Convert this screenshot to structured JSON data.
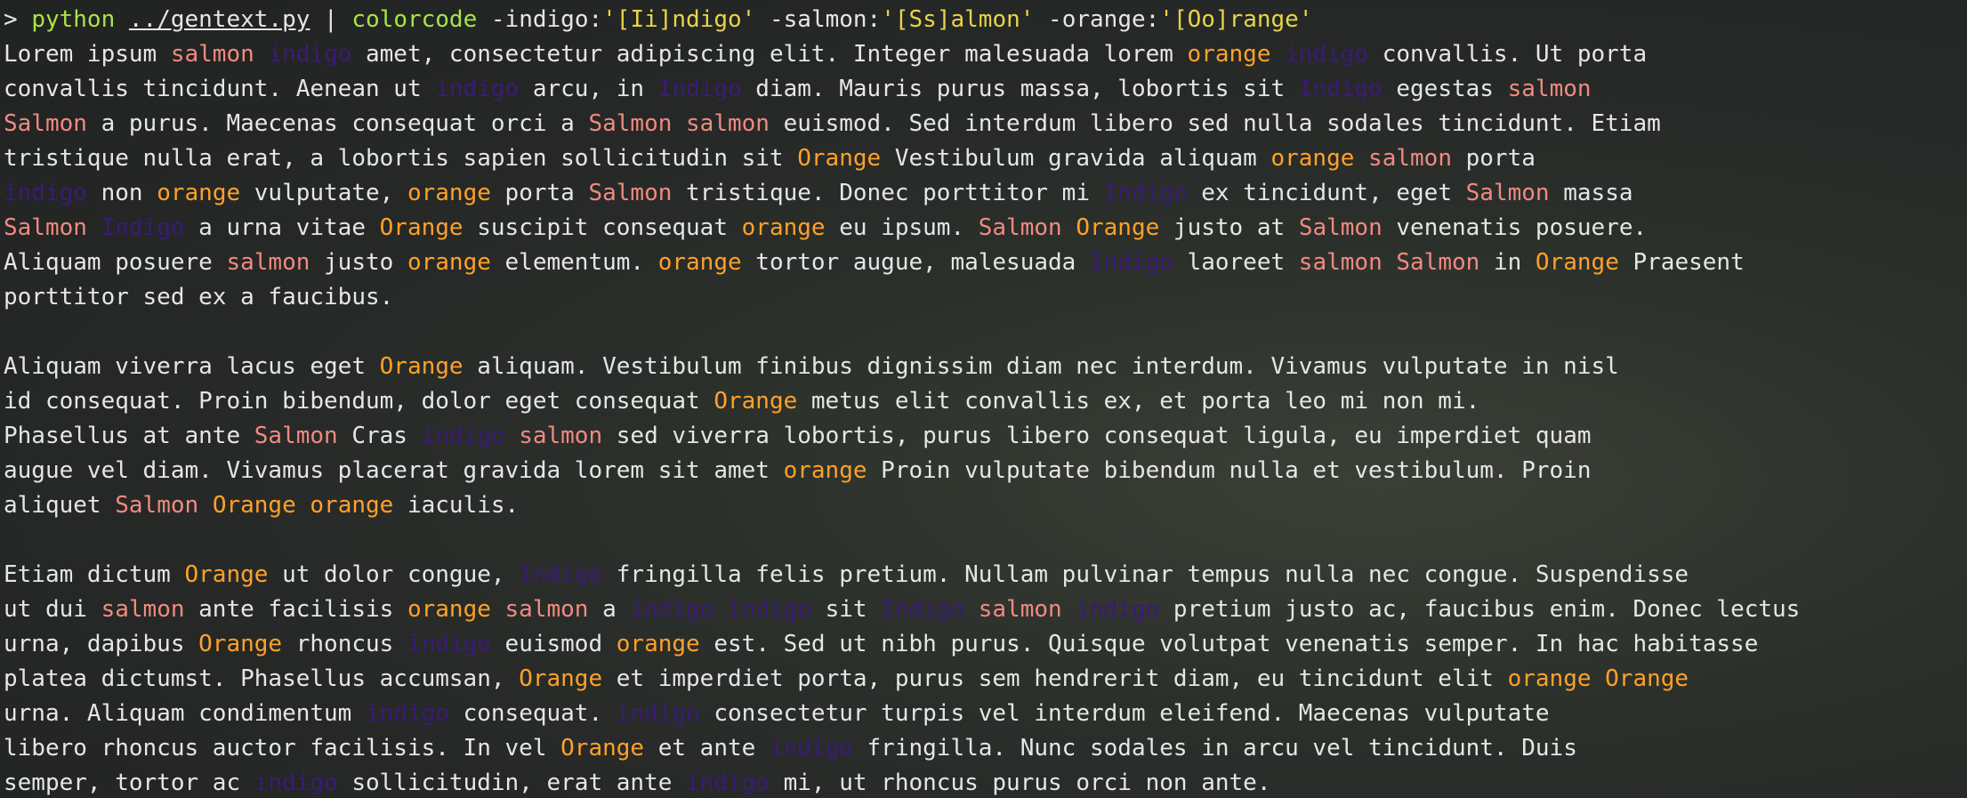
{
  "terminal": {
    "lines": [
      [
        [
          "prompt",
          "> "
        ],
        [
          "cmd",
          "python"
        ],
        [
          "arg",
          " "
        ],
        [
          "path",
          "../gentext.py"
        ],
        [
          "arg",
          " | "
        ],
        [
          "cmd",
          "colorcode"
        ],
        [
          "arg",
          " -indigo:"
        ],
        [
          "str",
          "'[Ii]ndigo'"
        ],
        [
          "arg",
          " -salmon:"
        ],
        [
          "str",
          "'[Ss]almon'"
        ],
        [
          "arg",
          " -orange:"
        ],
        [
          "str",
          "'[Oo]range'"
        ]
      ],
      [
        [
          "plain",
          "Lorem ipsum "
        ],
        [
          "salmon",
          "salmon"
        ],
        [
          "plain",
          " "
        ],
        [
          "indigo",
          "indigo"
        ],
        [
          "plain",
          " amet, consectetur adipiscing elit. Integer malesuada lorem "
        ],
        [
          "orange",
          "orange"
        ],
        [
          "plain",
          " "
        ],
        [
          "indigo",
          "indigo"
        ],
        [
          "plain",
          " convallis. Ut porta"
        ]
      ],
      [
        [
          "plain",
          "convallis tincidunt. Aenean ut "
        ],
        [
          "indigo",
          "indigo"
        ],
        [
          "plain",
          " arcu, in "
        ],
        [
          "indigo",
          "Indigo"
        ],
        [
          "plain",
          " diam. Mauris purus massa, lobortis sit "
        ],
        [
          "indigo",
          "Indigo"
        ],
        [
          "plain",
          " egestas "
        ],
        [
          "salmon",
          "salmon"
        ]
      ],
      [
        [
          "salmon",
          "Salmon"
        ],
        [
          "plain",
          " a purus. Maecenas consequat orci a "
        ],
        [
          "salmon",
          "Salmon"
        ],
        [
          "plain",
          " "
        ],
        [
          "salmon",
          "salmon"
        ],
        [
          "plain",
          " euismod. Sed interdum libero sed nulla sodales tincidunt. Etiam"
        ]
      ],
      [
        [
          "plain",
          "tristique nulla erat, a lobortis sapien sollicitudin sit "
        ],
        [
          "orange",
          "Orange"
        ],
        [
          "plain",
          " Vestibulum gravida aliquam "
        ],
        [
          "orange",
          "orange"
        ],
        [
          "plain",
          " "
        ],
        [
          "salmon",
          "salmon"
        ],
        [
          "plain",
          " porta"
        ]
      ],
      [
        [
          "indigo",
          "indigo"
        ],
        [
          "plain",
          " non "
        ],
        [
          "orange",
          "orange"
        ],
        [
          "plain",
          " vulputate, "
        ],
        [
          "orange",
          "orange"
        ],
        [
          "plain",
          " porta "
        ],
        [
          "salmon",
          "Salmon"
        ],
        [
          "plain",
          " tristique. Donec porttitor mi "
        ],
        [
          "indigo",
          "Indigo"
        ],
        [
          "plain",
          " ex tincidunt, eget "
        ],
        [
          "salmon",
          "Salmon"
        ],
        [
          "plain",
          " massa"
        ]
      ],
      [
        [
          "salmon",
          "Salmon"
        ],
        [
          "plain",
          " "
        ],
        [
          "indigo",
          "Indigo"
        ],
        [
          "plain",
          " a urna vitae "
        ],
        [
          "orange",
          "Orange"
        ],
        [
          "plain",
          " suscipit consequat "
        ],
        [
          "orange",
          "orange"
        ],
        [
          "plain",
          " eu ipsum. "
        ],
        [
          "salmon",
          "Salmon"
        ],
        [
          "plain",
          " "
        ],
        [
          "orange",
          "Orange"
        ],
        [
          "plain",
          " justo at "
        ],
        [
          "salmon",
          "Salmon"
        ],
        [
          "plain",
          " venenatis posuere."
        ]
      ],
      [
        [
          "plain",
          "Aliquam posuere "
        ],
        [
          "salmon",
          "salmon"
        ],
        [
          "plain",
          " justo "
        ],
        [
          "orange",
          "orange"
        ],
        [
          "plain",
          " elementum. "
        ],
        [
          "orange",
          "orange"
        ],
        [
          "plain",
          " tortor augue, malesuada "
        ],
        [
          "indigo",
          "Indigo"
        ],
        [
          "plain",
          " laoreet "
        ],
        [
          "salmon",
          "salmon"
        ],
        [
          "plain",
          " "
        ],
        [
          "salmon",
          "Salmon"
        ],
        [
          "plain",
          " in "
        ],
        [
          "orange",
          "Orange"
        ],
        [
          "plain",
          " Praesent"
        ]
      ],
      [
        [
          "plain",
          "porttitor sed ex a faucibus."
        ]
      ],
      [
        [
          "plain",
          " "
        ]
      ],
      [
        [
          "plain",
          "Aliquam viverra lacus eget "
        ],
        [
          "orange",
          "Orange"
        ],
        [
          "plain",
          " aliquam. Vestibulum finibus dignissim diam nec interdum. Vivamus vulputate in nisl"
        ]
      ],
      [
        [
          "plain",
          "id consequat. Proin bibendum, dolor eget consequat "
        ],
        [
          "orange",
          "Orange"
        ],
        [
          "plain",
          " metus elit convallis ex, et porta leo mi non mi."
        ]
      ],
      [
        [
          "plain",
          "Phasellus at ante "
        ],
        [
          "salmon",
          "Salmon"
        ],
        [
          "plain",
          " Cras "
        ],
        [
          "indigo",
          "indigo"
        ],
        [
          "plain",
          " "
        ],
        [
          "salmon",
          "salmon"
        ],
        [
          "plain",
          " sed viverra lobortis, purus libero consequat ligula, eu imperdiet quam"
        ]
      ],
      [
        [
          "plain",
          "augue vel diam. Vivamus placerat gravida lorem sit amet "
        ],
        [
          "orange",
          "orange"
        ],
        [
          "plain",
          " Proin vulputate bibendum nulla et vestibulum. Proin"
        ]
      ],
      [
        [
          "plain",
          "aliquet "
        ],
        [
          "salmon",
          "Salmon"
        ],
        [
          "plain",
          " "
        ],
        [
          "orange",
          "Orange"
        ],
        [
          "plain",
          " "
        ],
        [
          "orange",
          "orange"
        ],
        [
          "plain",
          " iaculis."
        ]
      ],
      [
        [
          "plain",
          " "
        ]
      ],
      [
        [
          "plain",
          "Etiam dictum "
        ],
        [
          "orange",
          "Orange"
        ],
        [
          "plain",
          " ut dolor congue, "
        ],
        [
          "indigo",
          "Indigo"
        ],
        [
          "plain",
          " fringilla felis pretium. Nullam pulvinar tempus nulla nec congue. Suspendisse"
        ]
      ],
      [
        [
          "plain",
          "ut dui "
        ],
        [
          "salmon",
          "salmon"
        ],
        [
          "plain",
          " ante facilisis "
        ],
        [
          "orange",
          "orange"
        ],
        [
          "plain",
          " "
        ],
        [
          "salmon",
          "salmon"
        ],
        [
          "plain",
          " a "
        ],
        [
          "indigo",
          "indigo"
        ],
        [
          "plain",
          " "
        ],
        [
          "indigo",
          "indigo"
        ],
        [
          "plain",
          " sit "
        ],
        [
          "indigo",
          "Indigo"
        ],
        [
          "plain",
          " "
        ],
        [
          "salmon",
          "salmon"
        ],
        [
          "plain",
          " "
        ],
        [
          "indigo",
          "indigo"
        ],
        [
          "plain",
          " pretium justo ac, faucibus enim. Donec lectus"
        ]
      ],
      [
        [
          "plain",
          "urna, dapibus "
        ],
        [
          "orange",
          "Orange"
        ],
        [
          "plain",
          " rhoncus "
        ],
        [
          "indigo",
          "indigo"
        ],
        [
          "plain",
          " euismod "
        ],
        [
          "orange",
          "orange"
        ],
        [
          "plain",
          " est. Sed ut nibh purus. Quisque volutpat venenatis semper. In hac habitasse"
        ]
      ],
      [
        [
          "plain",
          "platea dictumst. Phasellus accumsan, "
        ],
        [
          "orange",
          "Orange"
        ],
        [
          "plain",
          " et imperdiet porta, purus sem hendrerit diam, eu tincidunt elit "
        ],
        [
          "orange",
          "orange"
        ],
        [
          "plain",
          " "
        ],
        [
          "orange",
          "Orange"
        ]
      ],
      [
        [
          "plain",
          "urna. Aliquam condimentum "
        ],
        [
          "indigo",
          "indigo"
        ],
        [
          "plain",
          " consequat. "
        ],
        [
          "indigo",
          "indigo"
        ],
        [
          "plain",
          " consectetur turpis vel interdum eleifend. Maecenas vulputate"
        ]
      ],
      [
        [
          "plain",
          "libero rhoncus auctor facilisis. In vel "
        ],
        [
          "orange",
          "Orange"
        ],
        [
          "plain",
          " et ante "
        ],
        [
          "indigo",
          "indigo"
        ],
        [
          "plain",
          " fringilla. Nunc sodales in arcu vel tincidunt. Duis"
        ]
      ],
      [
        [
          "plain",
          "semper, tortor ac "
        ],
        [
          "indigo",
          "indigo"
        ],
        [
          "plain",
          " sollicitudin, erat ante "
        ],
        [
          "indigo",
          "indigo"
        ],
        [
          "plain",
          " mi, ut rhoncus purus orci non ante."
        ]
      ]
    ]
  }
}
